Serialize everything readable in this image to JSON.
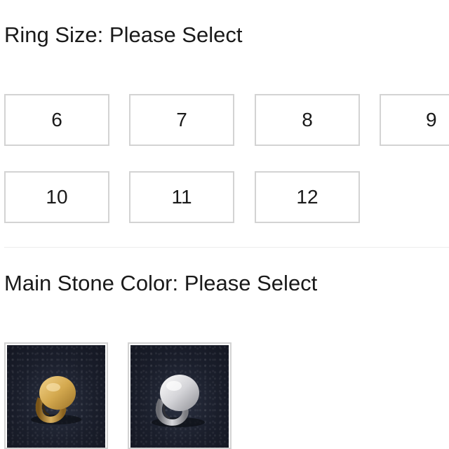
{
  "ring_size": {
    "label": "Ring Size: Please Select",
    "options": [
      "6",
      "7",
      "8",
      "9",
      "10",
      "11",
      "12"
    ]
  },
  "main_stone_color": {
    "label": "Main Stone Color: Please Select",
    "swatches": [
      {
        "icon": "gold-signet-ring-image",
        "ring_color": "#c9a04a"
      },
      {
        "icon": "silver-signet-ring-image",
        "ring_color": "#c8c8cc"
      }
    ]
  },
  "colors": {
    "border": "#d3d3d3",
    "text": "#1a1a1a",
    "photo_background": "#1a1e2b"
  }
}
